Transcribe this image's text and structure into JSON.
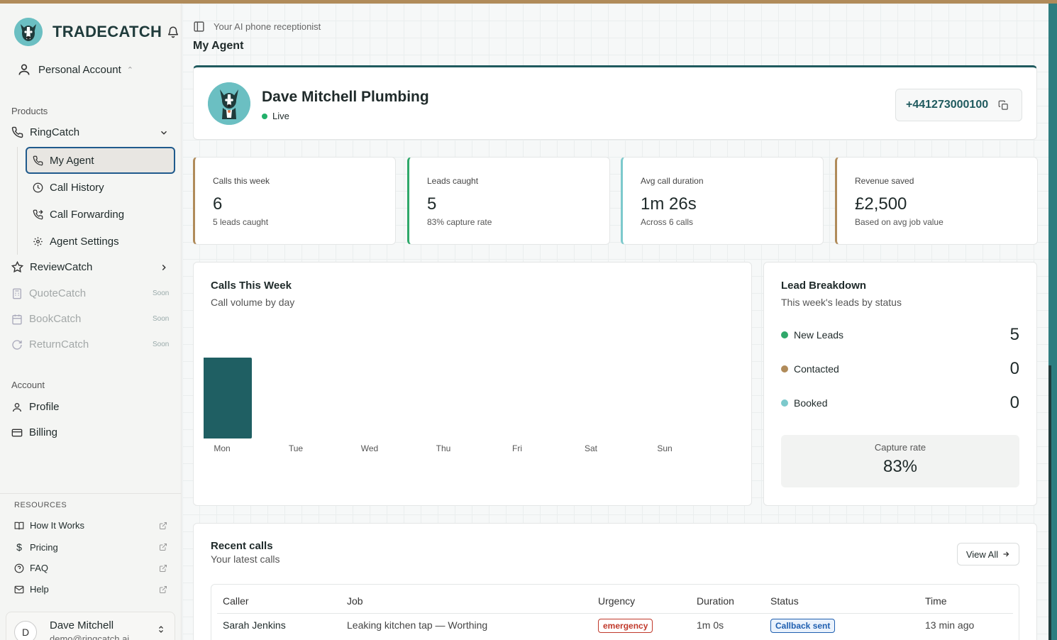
{
  "brand": {
    "name": "TRADECATCH"
  },
  "account_switcher": {
    "label": "Personal Account"
  },
  "sidebar": {
    "products_label": "Products",
    "ringcatch": "RingCatch",
    "sub_items": [
      "My Agent",
      "Call History",
      "Call Forwarding",
      "Agent Settings"
    ],
    "reviewcatch": "ReviewCatch",
    "soon_items": [
      {
        "label": "QuoteCatch",
        "badge": "Soon"
      },
      {
        "label": "BookCatch",
        "badge": "Soon"
      },
      {
        "label": "ReturnCatch",
        "badge": "Soon"
      }
    ],
    "account_label": "Account",
    "account_items": [
      "Profile",
      "Billing"
    ],
    "resources_label": "RESOURCES",
    "resources": [
      "How It Works",
      "Pricing",
      "FAQ",
      "Help"
    ],
    "user": {
      "initial": "D",
      "name": "Dave Mitchell",
      "email": "demo@ringcatch.ai"
    }
  },
  "header": {
    "breadcrumb": "Your AI phone receptionist",
    "title": "My Agent"
  },
  "agent": {
    "name": "Dave Mitchell Plumbing",
    "status": "Live",
    "phone": "+441273000100"
  },
  "stats": [
    {
      "label": "Calls this week",
      "value": "6",
      "sub": "5 leads caught",
      "accent": "#b08b5a"
    },
    {
      "label": "Leads caught",
      "value": "5",
      "sub": "83% capture rate",
      "accent": "#2fa86a"
    },
    {
      "label": "Avg call duration",
      "value": "1m 26s",
      "sub": "Across 6 calls",
      "accent": "#7cc9cc"
    },
    {
      "label": "Revenue saved",
      "value": "£2,500",
      "sub": "Based on avg job value",
      "accent": "#b08b5a"
    }
  ],
  "calls_chart": {
    "title": "Calls This Week",
    "subtitle": "Call volume by day"
  },
  "chart_data": {
    "type": "bar",
    "categories": [
      "Mon",
      "Tue",
      "Wed",
      "Thu",
      "Fri",
      "Sat",
      "Sun"
    ],
    "values": [
      6,
      0,
      0,
      0,
      0,
      0,
      0
    ],
    "title": "Calls This Week",
    "color": "#1f5f63",
    "grid": false
  },
  "leads": {
    "title": "Lead Breakdown",
    "subtitle": "This week's leads by status",
    "rows": [
      {
        "label": "New Leads",
        "value": "5",
        "color": "#2fa86a"
      },
      {
        "label": "Contacted",
        "value": "0",
        "color": "#b08b5a"
      },
      {
        "label": "Booked",
        "value": "0",
        "color": "#7cc9cc"
      }
    ],
    "capture_label": "Capture rate",
    "capture_value": "83%"
  },
  "recent": {
    "title": "Recent calls",
    "subtitle": "Your latest calls",
    "view_all": "View All",
    "columns": [
      "Caller",
      "Job",
      "Urgency",
      "Duration",
      "Status",
      "Time"
    ],
    "rows": [
      {
        "caller": "Sarah Jenkins",
        "job": "Leaking kitchen tap — Worthing",
        "urgency": "emergency",
        "duration": "1m 0s",
        "status": "Callback sent",
        "time": "13 min ago"
      }
    ]
  }
}
